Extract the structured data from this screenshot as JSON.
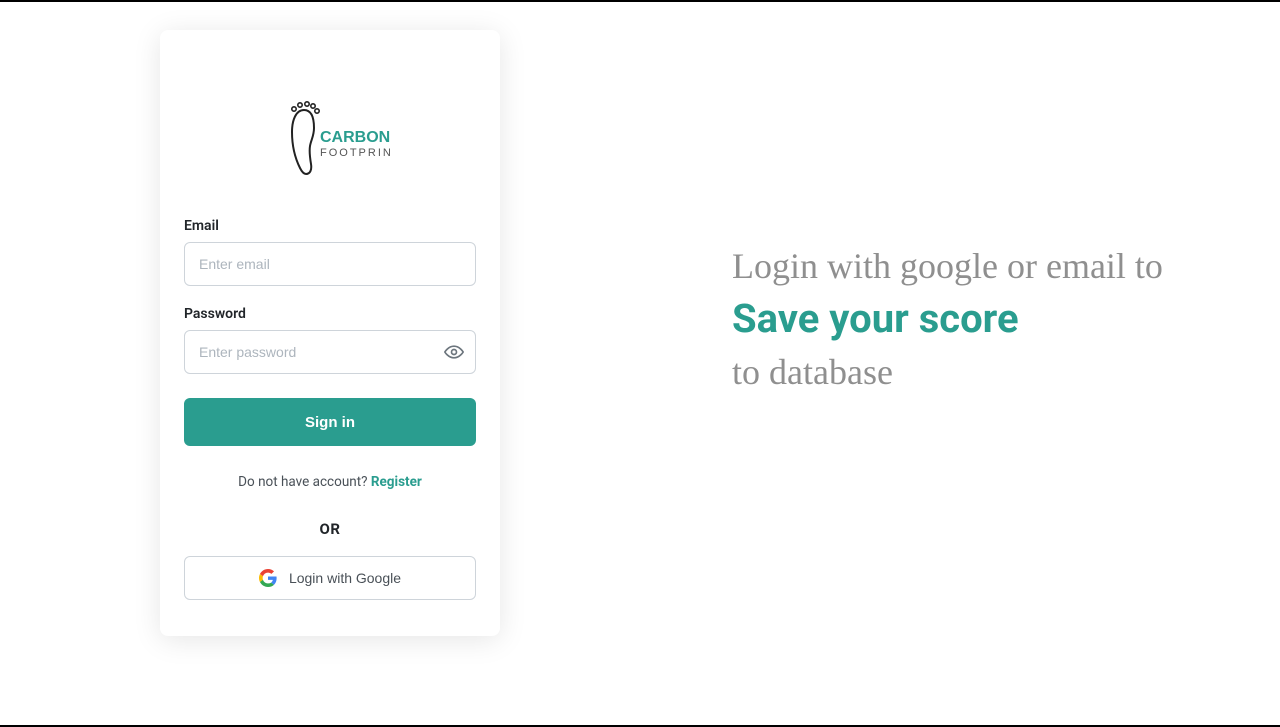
{
  "logo": {
    "line1": "CARBON",
    "line2": "FOOTPRINT"
  },
  "form": {
    "email_label": "Email",
    "email_placeholder": "Enter email",
    "password_label": "Password",
    "password_placeholder": "Enter password",
    "signin_label": "Sign in",
    "register_prompt": "Do not have account? ",
    "register_link": "Register",
    "or_label": "OR",
    "google_label": "Login with Google"
  },
  "tagline": {
    "line1": "Login with google or email to",
    "highlight": "Save your score",
    "line3": "to database"
  }
}
